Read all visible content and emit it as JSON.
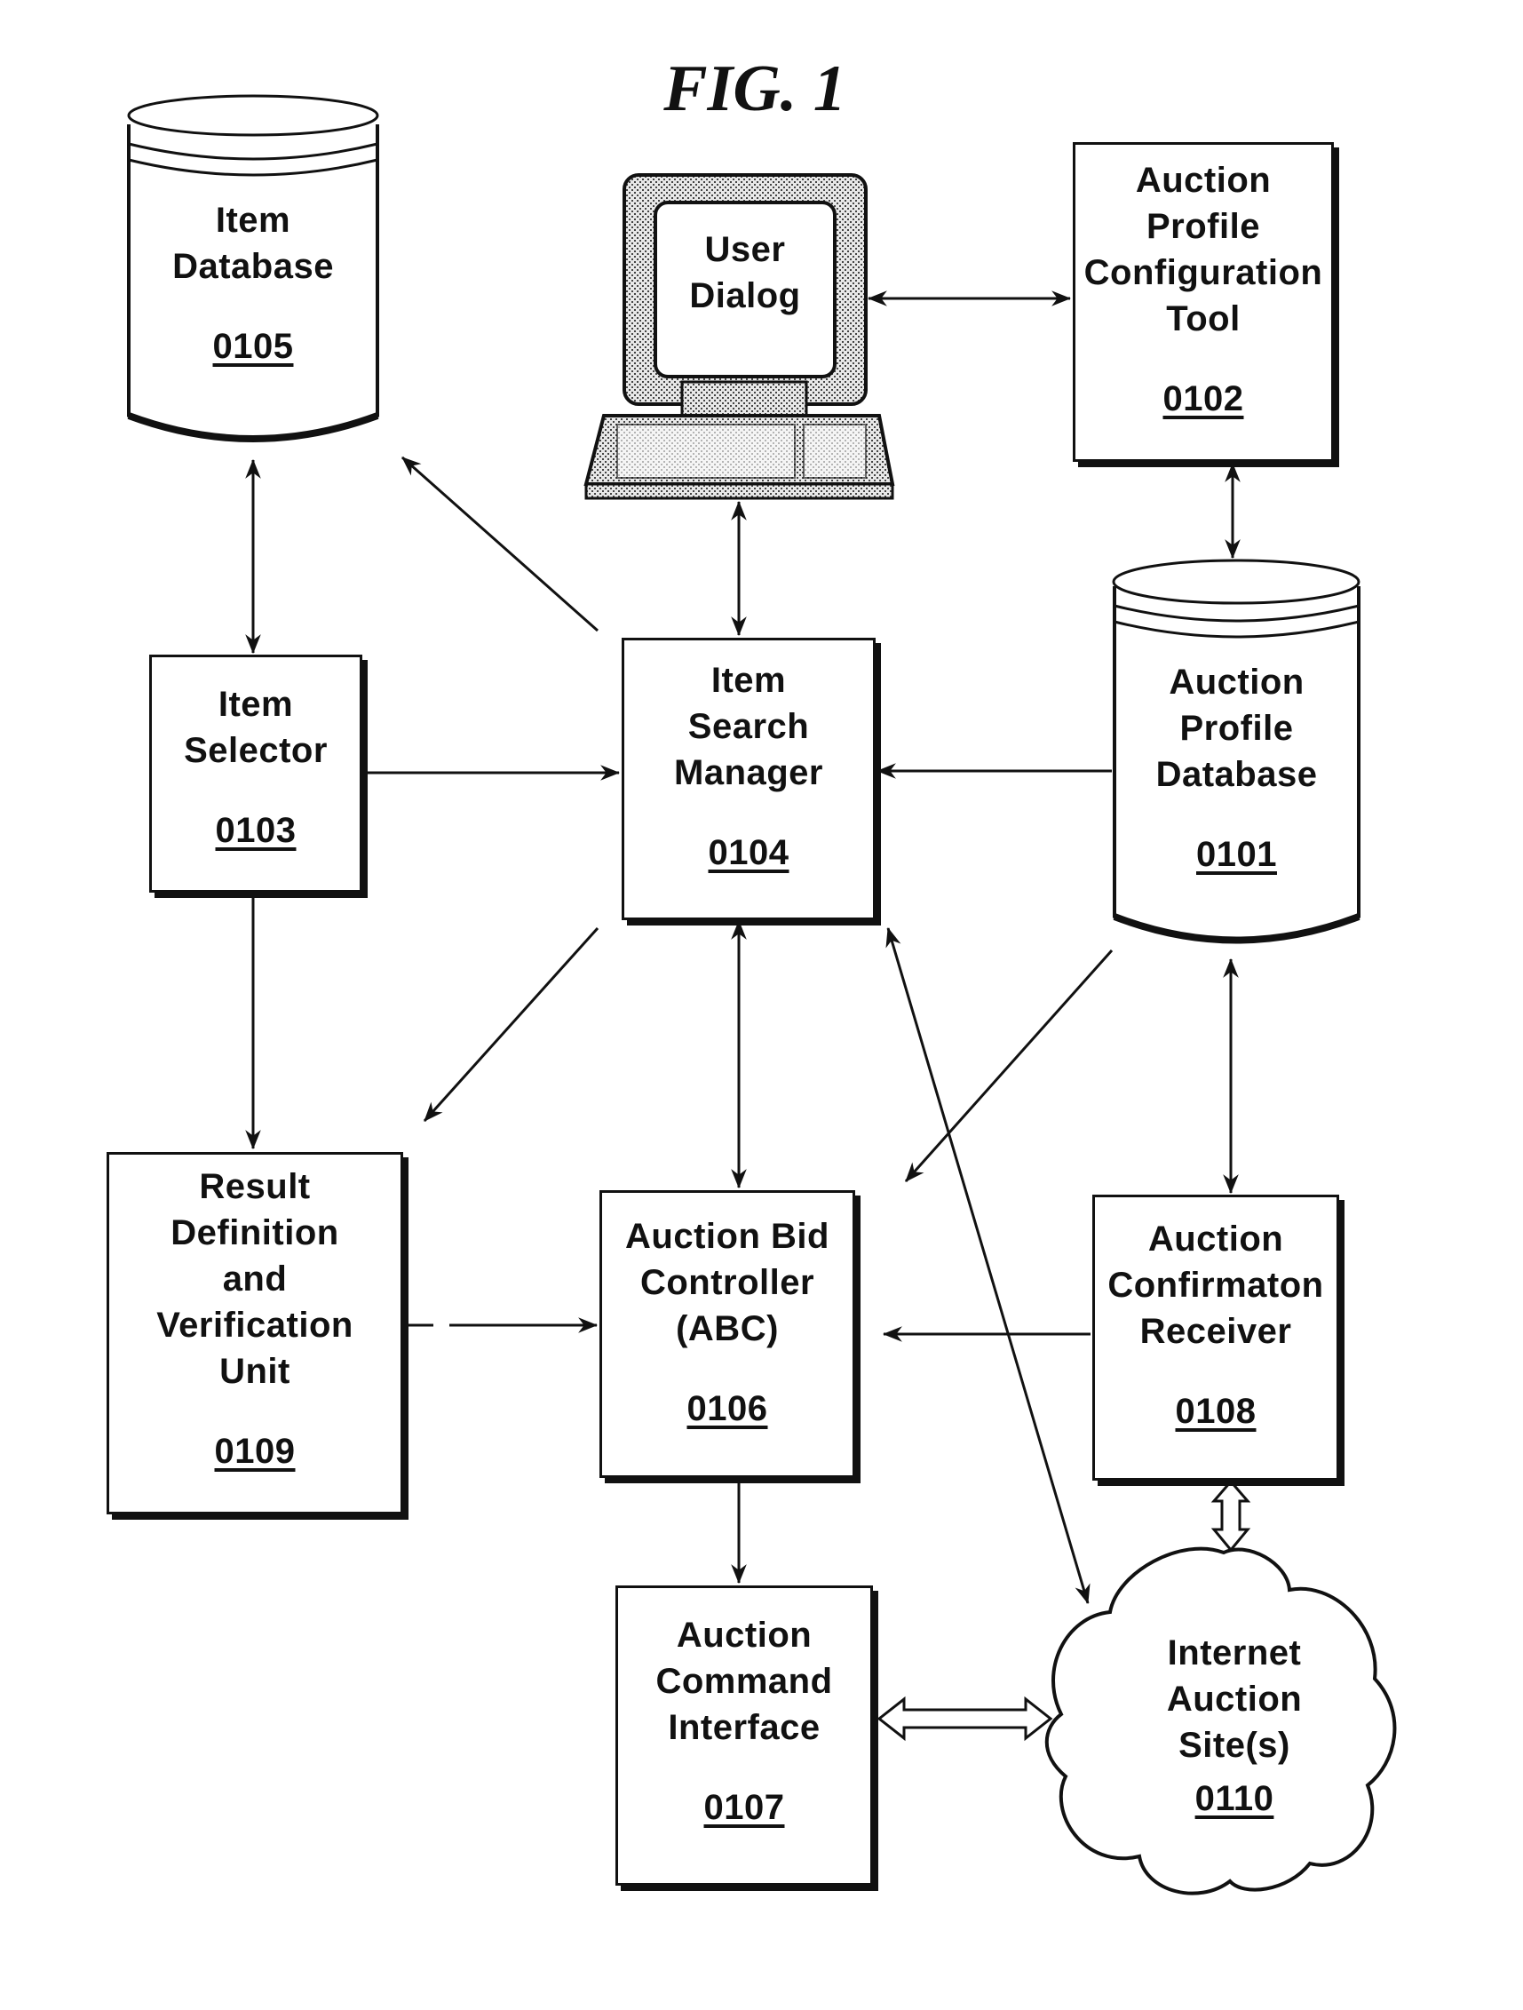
{
  "figure": {
    "title": "FIG. 1"
  },
  "nodes": {
    "item_database": {
      "shape": "cylinder",
      "lines": [
        "Item",
        "Database"
      ],
      "ref": "0105"
    },
    "user_dialog": {
      "shape": "computer",
      "lines": [
        "User",
        "Dialog"
      ]
    },
    "apct": {
      "shape": "box",
      "lines": [
        "Auction",
        "Profile",
        "Configuration",
        "Tool"
      ],
      "ref": "0102"
    },
    "item_selector": {
      "shape": "box",
      "lines": [
        "Item",
        "Selector"
      ],
      "ref": "0103"
    },
    "item_search_manager": {
      "shape": "box",
      "lines": [
        "Item",
        "Search",
        "Manager"
      ],
      "ref": "0104"
    },
    "auction_profile_database": {
      "shape": "cylinder",
      "lines": [
        "Auction",
        "Profile",
        "Database"
      ],
      "ref": "0101"
    },
    "result_definition": {
      "shape": "box",
      "lines": [
        "Result",
        "Definition",
        "and",
        "Verification",
        "Unit"
      ],
      "ref": "0109"
    },
    "auction_bid_controller": {
      "shape": "box",
      "lines": [
        "Auction Bid",
        "Controller",
        "(ABC)"
      ],
      "ref": "0106"
    },
    "auction_confirmation_receiver": {
      "shape": "box",
      "lines": [
        "Auction",
        "Confirmaton",
        "Receiver"
      ],
      "ref": "0108"
    },
    "auction_command_interface": {
      "shape": "box",
      "lines": [
        "Auction",
        "Command",
        "Interface"
      ],
      "ref": "0107"
    },
    "internet_auction_sites": {
      "shape": "cloud",
      "lines": [
        "Internet",
        "Auction",
        "Site(s)"
      ],
      "ref": "0110"
    }
  },
  "edges": [
    {
      "from": "item_database",
      "to": "item_selector",
      "style": "bidirectional"
    },
    {
      "from": "item_search_manager",
      "to": "item_database",
      "style": "directed"
    },
    {
      "from": "user_dialog",
      "to": "apct",
      "style": "bidirectional"
    },
    {
      "from": "user_dialog",
      "to": "item_search_manager",
      "style": "bidirectional"
    },
    {
      "from": "apct",
      "to": "auction_profile_database",
      "style": "bidirectional"
    },
    {
      "from": "item_selector",
      "to": "item_search_manager",
      "style": "directed"
    },
    {
      "from": "auction_profile_database",
      "to": "item_search_manager",
      "style": "directed"
    },
    {
      "from": "item_selector",
      "to": "result_definition",
      "style": "directed"
    },
    {
      "from": "item_search_manager",
      "to": "result_definition",
      "style": "directed"
    },
    {
      "from": "item_search_manager",
      "to": "auction_bid_controller",
      "style": "bidirectional"
    },
    {
      "from": "auction_profile_database",
      "to": "auction_bid_controller",
      "style": "directed"
    },
    {
      "from": "auction_profile_database",
      "to": "auction_confirmation_receiver",
      "style": "bidirectional"
    },
    {
      "from": "result_definition",
      "to": "auction_bid_controller",
      "style": "directed"
    },
    {
      "from": "auction_confirmation_receiver",
      "to": "auction_bid_controller",
      "style": "directed"
    },
    {
      "from": "internet_auction_sites",
      "to": "item_search_manager",
      "style": "bidirectional"
    },
    {
      "from": "auction_bid_controller",
      "to": "auction_command_interface",
      "style": "directed"
    },
    {
      "from": "auction_confirmation_receiver",
      "to": "internet_auction_sites",
      "style": "hollow-bidirectional"
    },
    {
      "from": "auction_command_interface",
      "to": "internet_auction_sites",
      "style": "hollow-bidirectional"
    }
  ]
}
